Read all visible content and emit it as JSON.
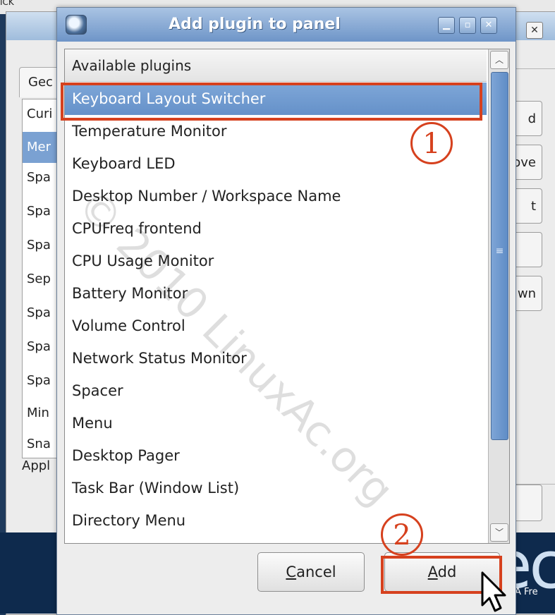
{
  "desktop": {
    "top_text": "ICK",
    "logo_text": "ec",
    "tagline": "A Fre"
  },
  "background_window": {
    "tab_label": "Gec",
    "list_items": [
      "Curi",
      "Mer",
      "Spa",
      "Spa",
      "Spa",
      "Sep",
      "Spa",
      "Spa",
      "Spa",
      "Min",
      "Sna"
    ],
    "selected_index": 1,
    "bottom_label": "Appl",
    "side_buttons": [
      "d",
      "ove",
      "t",
      "",
      "wn",
      ""
    ]
  },
  "dialog": {
    "title": "Add plugin to panel",
    "list_header": "Available plugins",
    "plugins": [
      "Keyboard Layout Switcher",
      "Temperature Monitor",
      "Keyboard LED",
      "Desktop Number / Workspace Name",
      "CPUFreq frontend",
      "CPU Usage Monitor",
      "Battery Monitor",
      "Volume Control",
      "Network Status Monitor",
      "Spacer",
      "Menu",
      "Desktop Pager",
      "Task Bar (Window List)",
      "Directory Menu"
    ],
    "selected_plugin_index": 0,
    "cancel_label_mnemonic": "C",
    "cancel_label_rest": "ancel",
    "add_label_mnemonic": "A",
    "add_label_rest": "dd",
    "scroll_grip": "≡"
  },
  "watermark": "© 2010 LinuxAc.org",
  "annotations": {
    "step1": "1",
    "step2": "2",
    "color": "#d6411e"
  },
  "icons": {
    "minimize": "▁",
    "maximize": "▫",
    "close": "✕",
    "scroll_up": "︿",
    "scroll_down": "﹀"
  }
}
